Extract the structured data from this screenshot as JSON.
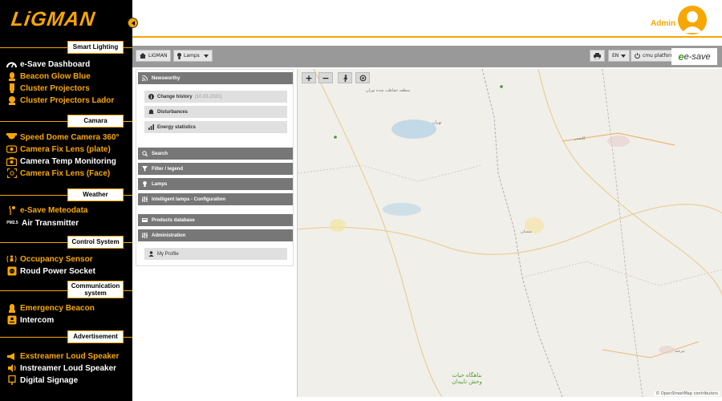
{
  "brand": {
    "logo_text": "LiGMAN"
  },
  "colors": {
    "accent": "#f7a700",
    "sidebar_bg": "#000000",
    "toolbar_bg": "#999999",
    "panel_header": "#777777"
  },
  "header": {
    "user_name": "Admin"
  },
  "sidebar": {
    "sections": {
      "smart_lighting": "Smart Lighting",
      "camera": "Camara",
      "weather": "Weather",
      "control_system": "Control System",
      "communication_system": "Communication system",
      "advertisement": "Advertisement"
    },
    "items": {
      "esave_dashboard": "e-Save Dashboard",
      "beacon_glow_blue": "Beacon Glow Blue",
      "cluster_projectors": "Cluster Projectors",
      "cluster_projectors_lador": "Cluster Projectors Lador",
      "speed_dome_camera": "Speed Dome Camera 360°",
      "camera_fix_lens_plate": "Camera Fix Lens (plate)",
      "camera_temp_monitoring": "Camera Temp Monitoring",
      "camera_fix_lens_face": "Camera Fix Lens (Face)",
      "esave_meteodata": "e-Save Meteodata",
      "air_transmitter": "Air Transmitter",
      "pm25_icon_text": "PM2.5",
      "occupancy_sensor": "Occupancy Sensor",
      "roud_power_socket": "Roud Power Socket",
      "emergency_beacon": "Emergency Beacon",
      "intercom": "Intercom",
      "exstreamer_loud_speaker": "Exstreamer Loud Speaker",
      "instreamer_loud_speaker": "Instreamer Loud Speaker",
      "digital_signage": "Digital Signage"
    }
  },
  "toolbar": {
    "home_label": "LiGMAN",
    "lamps_label": "Lamps",
    "language": "EN",
    "cmu_platform": "cmu platform",
    "esave_logo": "e-save"
  },
  "panel": {
    "newsworthy": "Newsworthy",
    "change_history": "Change history",
    "change_history_date": "(10.03.2021)",
    "disturbances": "Disturbances",
    "energy_statistics": "Energy statistics",
    "search": "Search",
    "filter_legend": "Filter / legend",
    "lamps": "Lamps",
    "intelligent_lamps": "Intelligent lamps - Configuration",
    "products_database": "Products database",
    "administration": "Administration",
    "my_profile": "My Profile"
  },
  "map": {
    "zoom_in": "+",
    "zoom_out": "−",
    "attribution": "© OpenStreetMap contributors",
    "labels": [
      "تهران",
      "کاشمر",
      "سمنان",
      "نیرجند",
      "بناهگاه حیات وحش نابیدان",
      "منطقه حفاظت شده توران"
    ]
  }
}
